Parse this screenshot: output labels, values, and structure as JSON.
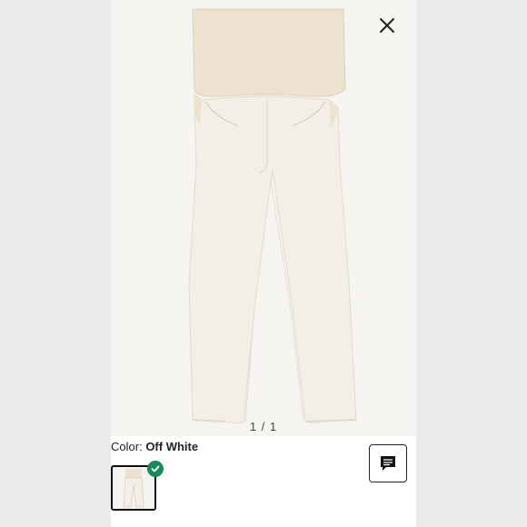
{
  "product": {
    "image_alt": "Maternity full-panel flare jeans, off white",
    "image_icon": "jeans-illustration"
  },
  "pager": {
    "text": "1 / 1"
  },
  "color": {
    "label": "Color:",
    "value": "Off White",
    "swatch_hex": "#efeae0"
  },
  "icons": {
    "close": "close-icon",
    "check": "check-icon",
    "chat": "chat-icon"
  },
  "colors": {
    "accent": "#1a8a5a",
    "panel": "#ece2cf",
    "denim": "#f3efe7"
  }
}
